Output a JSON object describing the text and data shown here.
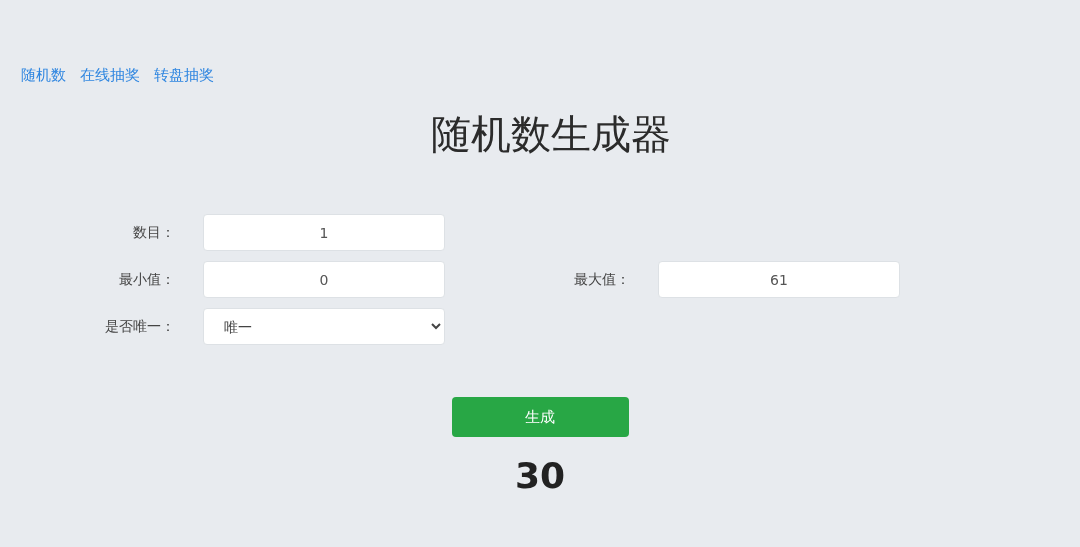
{
  "nav": [
    {
      "label": "随机数"
    },
    {
      "label": "在线抽奖"
    },
    {
      "label": "转盘抽奖"
    }
  ],
  "title": "随机数生成器",
  "form_rows": [
    [
      {
        "kind": "text",
        "label": "数目：",
        "value": "1"
      }
    ],
    [
      {
        "kind": "text",
        "label": "最小值：",
        "value": "0"
      },
      {
        "kind": "text",
        "label": "最大值：",
        "value": "61"
      }
    ],
    [
      {
        "kind": "select",
        "label": "是否唯一：",
        "value": "唯一"
      }
    ]
  ],
  "generate_button": "生成",
  "result": "30"
}
